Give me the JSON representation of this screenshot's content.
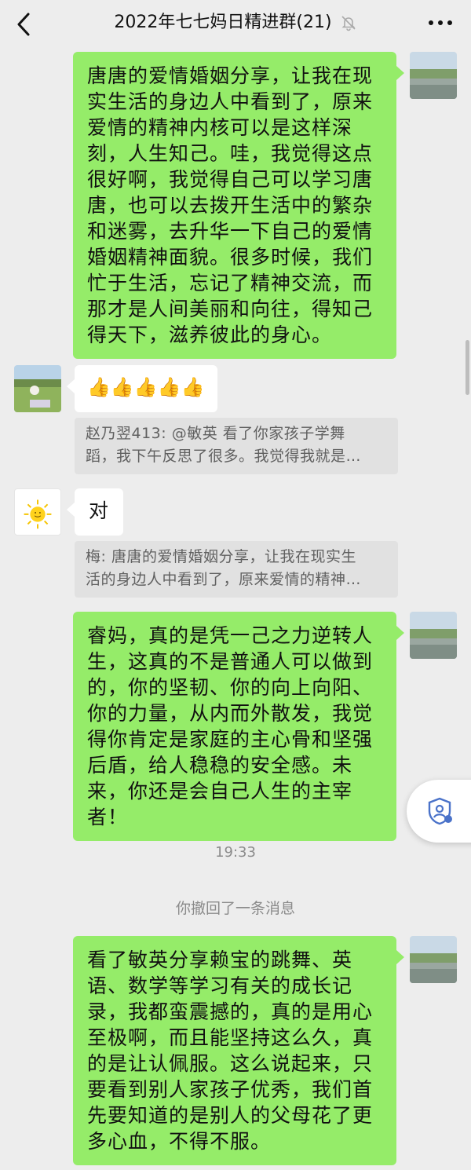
{
  "header": {
    "title": "2022年七七妈日精进群(21)",
    "back_icon": "chevron-left-icon",
    "mute_icon": "bell-off-icon",
    "more_icon": "more-dots-icon"
  },
  "messages": [
    {
      "side": "right",
      "type": "text",
      "text": "唐唐的爱情婚姻分享，让我在现实生活的身边人中看到了，原来爱情的精神内核可以是这样深刻，人生知己。哇，我觉得这点很好啊，我觉得自己可以学习唐唐，也可以去拨开生活中的繁杂和迷雾，去升华一下自己的爱情婚姻精神面貌。很多时候，我们忙于生活，忘记了精神交流，而那才是人间美丽和向往，得知己得天下，滋养彼此的身心。"
    },
    {
      "side": "left",
      "type": "emoji",
      "text": "👍👍👍👍👍"
    },
    {
      "type": "quote",
      "line1": "赵乃翌413: @敏英 看了你家孩子学舞",
      "line2": "蹈，我下午反思了很多。我觉得我就是…"
    },
    {
      "side": "left",
      "type": "text",
      "text": "对"
    },
    {
      "type": "quote",
      "line1": "梅: 唐唐的爱情婚姻分享，让我在现实生",
      "line2": "活的身边人中看到了，原来爱情的精神…"
    },
    {
      "side": "right",
      "type": "text",
      "text": "睿妈，真的是凭一己之力逆转人生，这真的不是普通人可以做到的，你的坚韧、你的向上向阳、你的力量，从内而外散发，我觉得你肯定是家庭的主心骨和坚强后盾，给人稳稳的安全感。未来，你还是会自己人生的主宰者！"
    },
    {
      "type": "time",
      "text": "19:33"
    },
    {
      "type": "system",
      "text": "你撤回了一条消息"
    },
    {
      "side": "right",
      "type": "text",
      "text": "看了敏英分享赖宝的跳舞、英语、数学等学习有关的成长记录，我都蛮震撼的，真的是用心至极啊，而且能坚持这么久，真的是让认佩服。这么说起来，只要看到别人家孩子优秀，我们首先要知道的是别人的父母花了更多心血，不得不服。"
    }
  ],
  "colors": {
    "background": "#ededed",
    "my_bubble": "#95ec69",
    "other_bubble": "#ffffff",
    "quote_bg": "#e1e1e1",
    "secondary_text": "#8b8b8b"
  },
  "floating_button": {
    "icon": "shield-person-icon"
  }
}
